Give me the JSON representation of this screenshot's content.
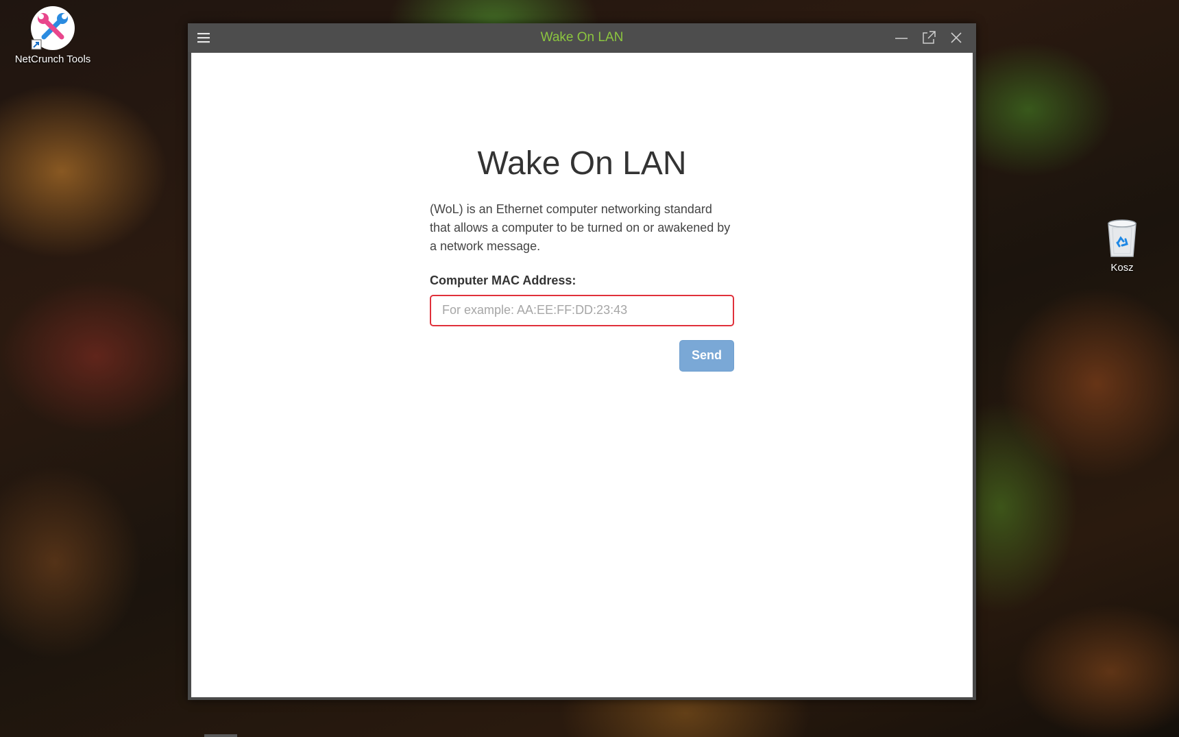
{
  "desktop": {
    "icons": [
      {
        "label": "NetCrunch Tools",
        "icon": "netcrunch-tools-icon"
      },
      {
        "label": "Kosz",
        "icon": "recycle-bin-icon"
      }
    ]
  },
  "window": {
    "title": "Wake On LAN",
    "title_color": "#8cc63f",
    "controls": [
      "menu-icon",
      "minimize-icon",
      "popout-icon",
      "close-icon"
    ]
  },
  "main": {
    "heading": "Wake On LAN",
    "description": "(WoL) is an Ethernet computer networking standard that allows a computer to be turned on or awakened by a network message.",
    "mac_label": "Computer MAC Address:",
    "mac_value": "",
    "mac_placeholder": "For example: AA:EE:FF:DD:23:43",
    "send_label": "Send",
    "accent_color": "#7aa8d6",
    "error_border_color": "#e0303a"
  }
}
